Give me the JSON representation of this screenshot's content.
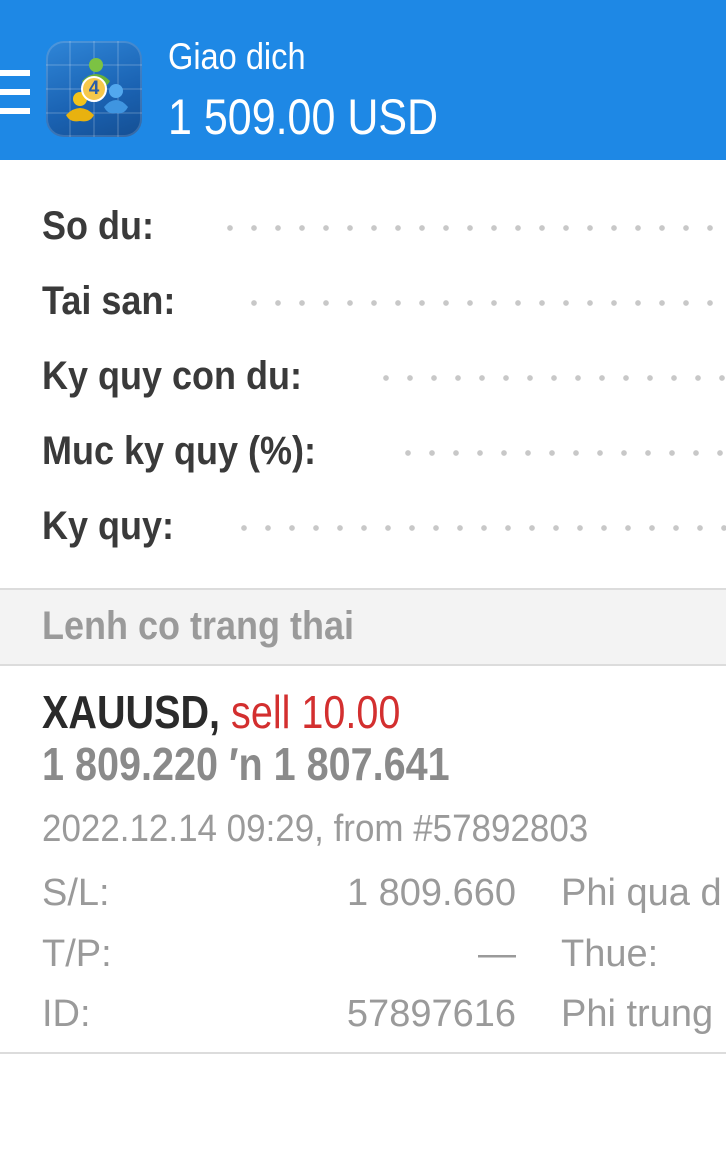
{
  "app_bar": {
    "title": "Giao dich",
    "subtitle": "1 509.00 USD",
    "logo_badge": "4"
  },
  "summary": [
    {
      "label": "So du:"
    },
    {
      "label": "Tai san:"
    },
    {
      "label": "Ky quy con du:"
    },
    {
      "label": "Muc ky quy (%):"
    },
    {
      "label": "Ky quy:"
    }
  ],
  "positions_section": {
    "title": "Lenh co trang thai"
  },
  "position": {
    "symbol": "XAUUSD,",
    "side": "sell 10.00",
    "prices": "1 809.220 ′n  1 807.641",
    "time": "2022.12.14 09:29, from #57892803",
    "details": [
      {
        "label": "S/L:",
        "value": "1 809.660",
        "label2": "Phi qua d"
      },
      {
        "label": "T/P:",
        "value": "—",
        "label2": "Thue:"
      },
      {
        "label": "ID:",
        "value": "57897616",
        "label2": "Phi trung"
      }
    ]
  },
  "colors": {
    "app_bar": "#1e88e5",
    "sell": "#d32f2f",
    "label_dark": "#3a3a3a",
    "label_grey": "#9a9a9a"
  }
}
